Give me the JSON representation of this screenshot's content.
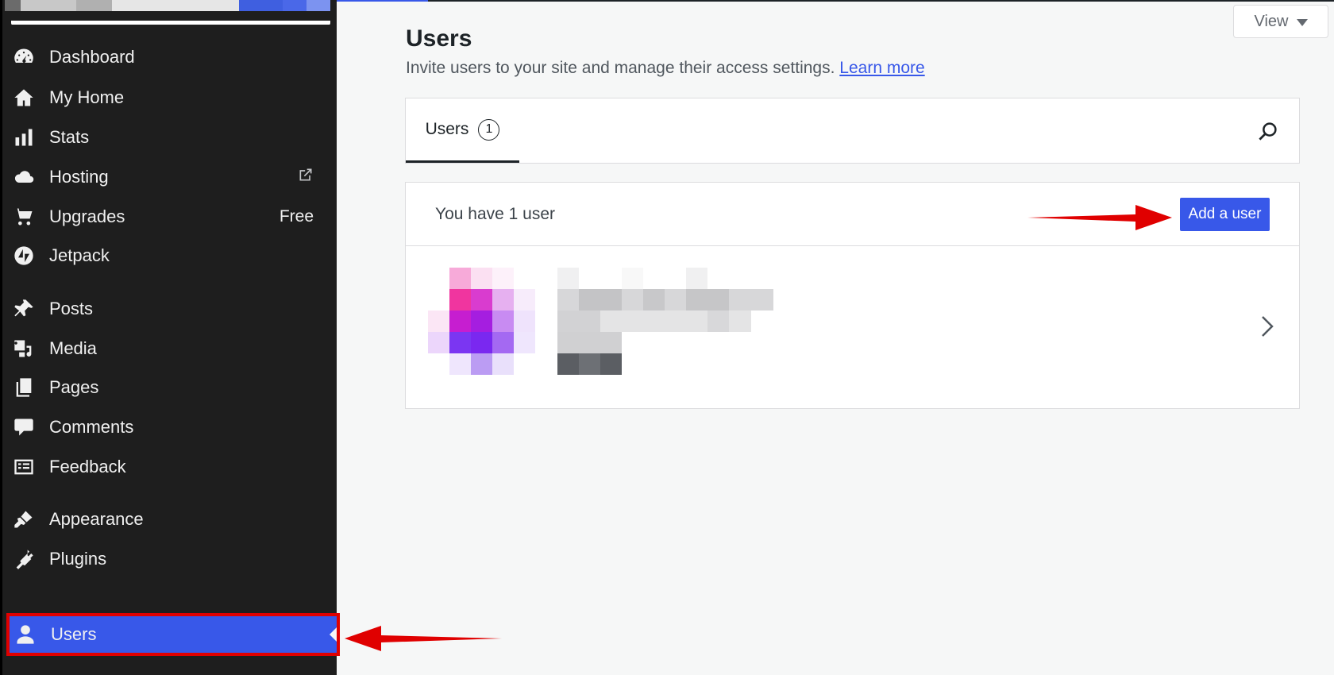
{
  "sidebar": {
    "items": [
      {
        "label": "Dashboard",
        "icon": "dashboard-icon"
      },
      {
        "label": "My Home",
        "icon": "home-icon"
      },
      {
        "label": "Stats",
        "icon": "stats-icon"
      },
      {
        "label": "Hosting",
        "icon": "cloud-icon",
        "extra_icon": "external-link-icon"
      },
      {
        "label": "Upgrades",
        "icon": "cart-icon",
        "badge": "Free"
      },
      {
        "label": "Jetpack",
        "icon": "jetpack-icon"
      },
      {
        "label": "Posts",
        "icon": "pin-icon"
      },
      {
        "label": "Media",
        "icon": "media-icon"
      },
      {
        "label": "Pages",
        "icon": "pages-icon"
      },
      {
        "label": "Comments",
        "icon": "comment-icon"
      },
      {
        "label": "Feedback",
        "icon": "feedback-icon"
      },
      {
        "label": "Appearance",
        "icon": "brush-icon"
      },
      {
        "label": "Plugins",
        "icon": "plug-icon"
      },
      {
        "label": "Users",
        "icon": "user-icon",
        "active": true
      }
    ]
  },
  "header": {
    "view_label": "View",
    "title": "Users",
    "subtitle": "Invite users to your site and manage their access settings.",
    "learn_more": "Learn more"
  },
  "tabs": [
    {
      "label": "Users",
      "count": "1"
    }
  ],
  "users_panel": {
    "summary": "You have 1 user",
    "add_button": "Add a user"
  },
  "colors": {
    "accent": "#3858e9",
    "sidebar_bg": "#1e1e1e",
    "annotation": "#e00000"
  }
}
